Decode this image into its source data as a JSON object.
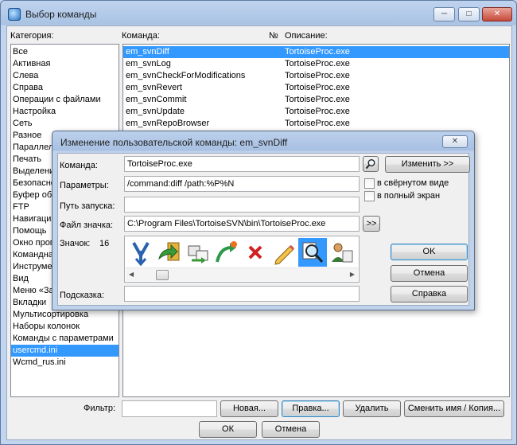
{
  "window": {
    "title": "Выбор команды",
    "min_label": "─",
    "max_label": "□",
    "close_label": "✕"
  },
  "headers": {
    "category": "Категория:",
    "command": "Команда:",
    "number": "№",
    "description": "Описание:"
  },
  "categories": [
    "Все",
    "Активная",
    "Слева",
    "Справа",
    "Операции с файлами",
    "Настройка",
    "Сеть",
    "Разное",
    "Параллел",
    "Печать",
    "Выделени",
    "Безопасно",
    "Буфер обм",
    "FTP",
    "Навигация",
    "Помощь",
    "Окно прог",
    "Командна",
    "Инструмен",
    "Вид",
    "Меню «За",
    "Вкладки",
    "Мультисортировка",
    "Наборы колонок",
    "Команды с параметрами",
    "usercmd.ini",
    "Wcmd_rus.ini"
  ],
  "selected_category_index": 25,
  "commands": [
    {
      "name": "em_svnDiff",
      "desc": "TortoiseProc.exe"
    },
    {
      "name": "em_svnLog",
      "desc": "TortoiseProc.exe"
    },
    {
      "name": "em_svnCheckForModifications",
      "desc": "TortoiseProc.exe"
    },
    {
      "name": "em_svnRevert",
      "desc": "TortoiseProc.exe"
    },
    {
      "name": "em_svnCommit",
      "desc": "TortoiseProc.exe"
    },
    {
      "name": "em_svnUpdate",
      "desc": "TortoiseProc.exe"
    },
    {
      "name": "em_svnRepoBrowser",
      "desc": "TortoiseProc.exe"
    }
  ],
  "selected_command_index": 0,
  "bottom": {
    "filter_label": "Фильтр:",
    "filter_value": "",
    "new_button": "Новая...",
    "edit_button": "Правка...",
    "delete_button": "Удалить",
    "rename_button": "Сменить имя / Копия...",
    "ok_button": "ОК",
    "cancel_button": "Отмена"
  },
  "dialog": {
    "title": "Изменение пользовательской команды: em_svnDiff",
    "close_label": "✕",
    "command_label": "Команда:",
    "command_value": "TortoiseProc.exe",
    "browse_icon": "magnifier-icon",
    "change_button": "Изменить >>",
    "params_label": "Параметры:",
    "params_value": "/command:diff /path:%P%N",
    "minimized_label": "в свёрнутом виде",
    "fullscreen_label": "в полный экран",
    "startpath_label": "Путь запуска:",
    "startpath_value": "",
    "iconfile_label": "Файл значка:",
    "iconfile_value": "C:\\Program Files\\TortoiseSVN\\bin\\TortoiseProc.exe",
    "iconfile_browse": ">>",
    "icon_label": "Значок:",
    "icon_index": "16",
    "icons": [
      "svn-update-icon",
      "svn-commit-icon",
      "svn-switch-icon",
      "svn-merge-icon",
      "svn-delete-icon",
      "svn-rename-icon",
      "svn-diff-icon",
      "svn-blame-icon"
    ],
    "selected_icon_index": 6,
    "ok_button": "OK",
    "cancel_button": "Отмена",
    "help_button": "Справка",
    "tooltip_label": "Подсказка:",
    "tooltip_value": ""
  },
  "colors": {
    "selection": "#3399ff",
    "frame": "#c2d5ee"
  }
}
